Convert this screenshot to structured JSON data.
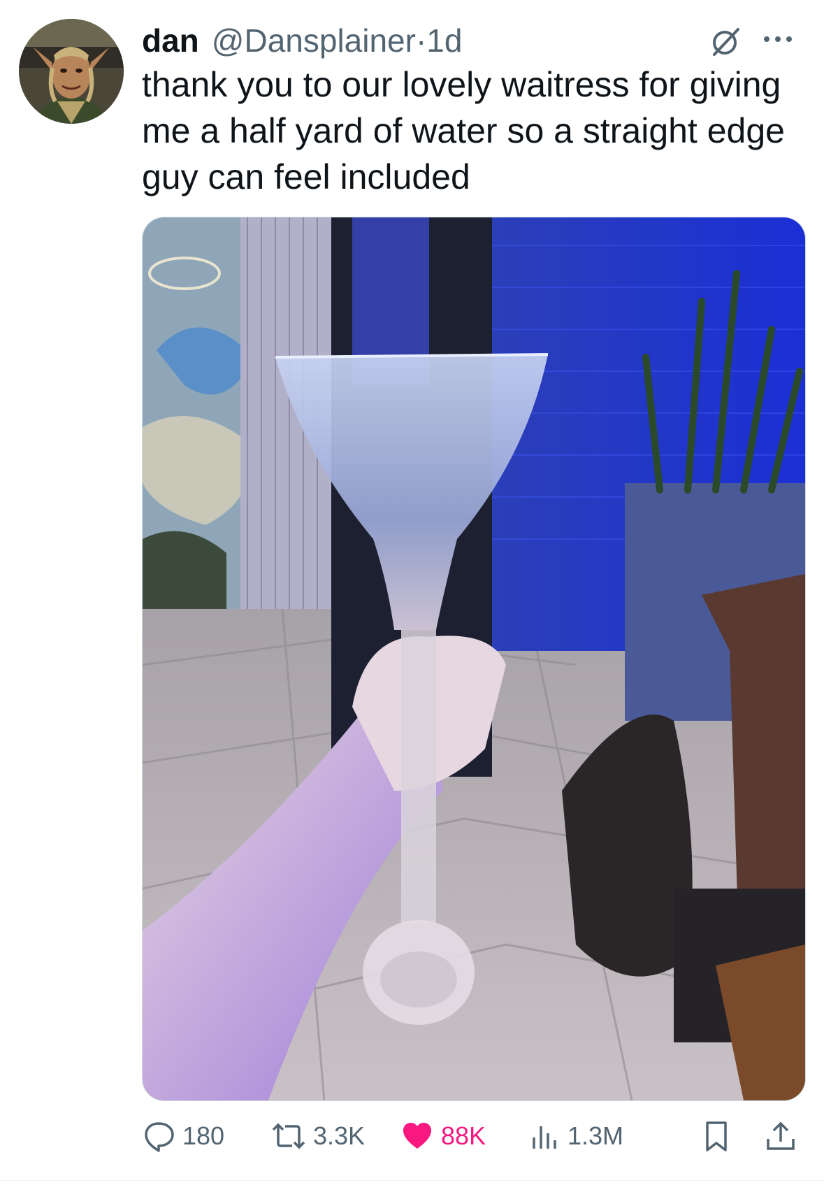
{
  "tweet": {
    "display_name": "dan",
    "handle": "@Dansplainer",
    "separator": "·",
    "time": "1d",
    "text": "thank you to our lovely waitress for giving me a half yard of water so a straight edge guy can feel included"
  },
  "actions": {
    "replies": "180",
    "reposts": "3.3K",
    "likes": "88K",
    "views": "1.3M"
  },
  "colors": {
    "like_active": "#f91880",
    "muted_text": "#536471",
    "primary_text": "#0f1419"
  },
  "icons": [
    "grok-icon",
    "more-icon",
    "reply-icon",
    "repost-icon",
    "heart-icon",
    "views-icon",
    "bookmark-icon",
    "share-icon"
  ]
}
